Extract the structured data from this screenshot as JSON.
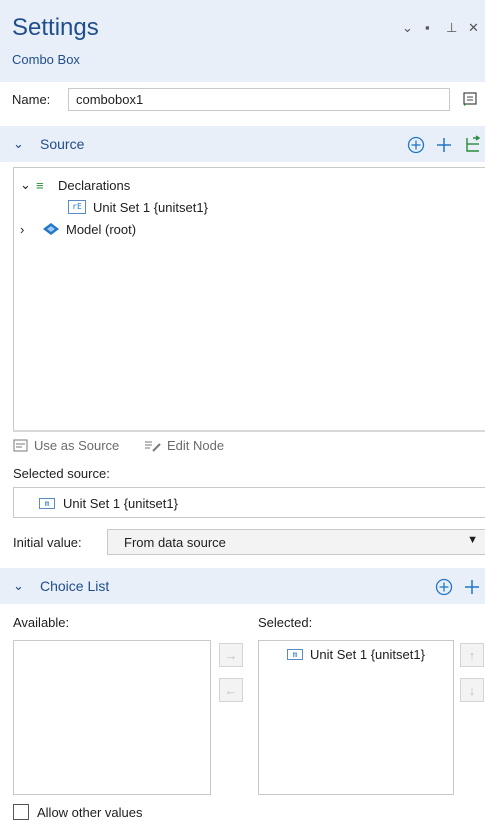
{
  "header": {
    "title": "Settings",
    "subtitle": "Combo Box"
  },
  "window_buttons": {
    "collapse": "⌄",
    "maximize": "▪",
    "pin": "⊥",
    "close": "✕"
  },
  "name_row": {
    "label": "Name:",
    "value": "combobox1"
  },
  "source": {
    "title": "Source",
    "tree": {
      "declarations": "Declarations",
      "unit_set": "Unit Set 1 {unitset1}",
      "model": "Model (root)"
    },
    "use_as_source": "Use as Source",
    "edit_node": "Edit Node",
    "selected_source_label": "Selected source:",
    "selected_source_value": "Unit Set 1 {unitset1}",
    "initial_value_label": "Initial value:",
    "initial_value": "From data source"
  },
  "choice_list": {
    "title": "Choice List",
    "available_label": "Available:",
    "selected_label": "Selected:",
    "selected_items": [
      "Unit Set 1 {unitset1}"
    ],
    "allow_other_values": "Allow other values"
  },
  "icons": {
    "unit_box_glyph": "m",
    "unit_set_tree_glyph": "rE"
  },
  "colors": {
    "accent": "#1f4e8c",
    "header_bg": "#e9eff8",
    "icon_blue": "#1f77c8",
    "icon_green": "#2a8a3a"
  }
}
